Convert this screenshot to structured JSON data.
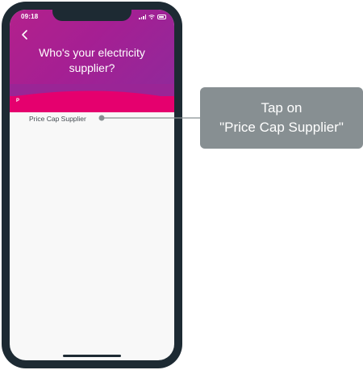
{
  "status_bar": {
    "time": "09:18"
  },
  "header": {
    "title": "Who's your electricity supplier?"
  },
  "list": {
    "section_letter": "P",
    "items": [
      {
        "label": "Price Cap Supplier"
      }
    ]
  },
  "callout": {
    "line1": "Tap on",
    "line2": "\"Price Cap Supplier\""
  },
  "colors": {
    "header_gradient_start": "#b3218c",
    "header_gradient_end": "#8f2a9b",
    "section_bar": "#e5006e",
    "callout_bg": "#878f92",
    "phone_frame": "#1d2a33"
  },
  "icons": [
    "back-arrow-icon",
    "signal-icon",
    "wifi-icon",
    "battery-icon"
  ]
}
